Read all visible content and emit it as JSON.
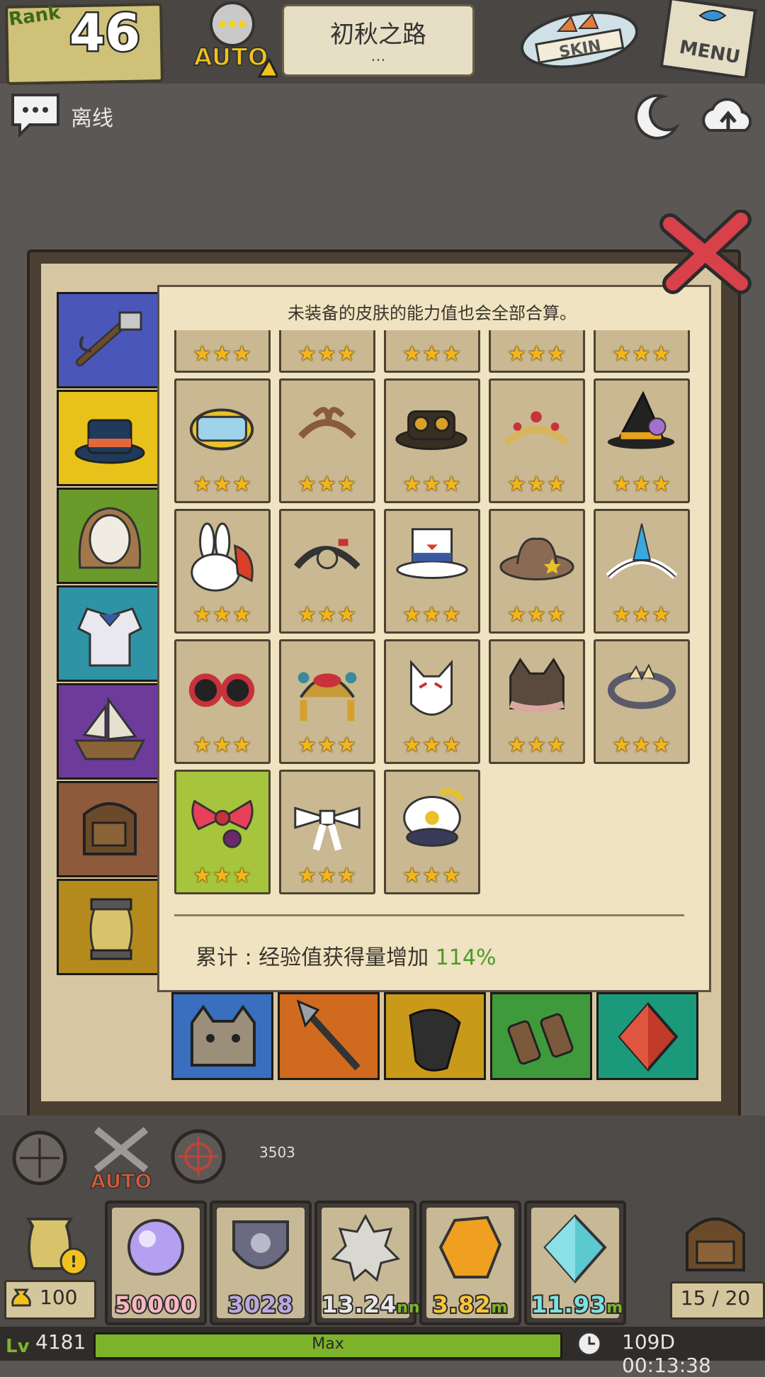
{
  "header": {
    "rank_label": "Rank",
    "rank_value": "46",
    "auto_label": "AUTO",
    "stage_title": "初秋之路",
    "stage_sub": "...",
    "skin_label": "SKIN",
    "menu_label": "MENU"
  },
  "status": {
    "connection": "离线"
  },
  "panel": {
    "note": "未装备的皮肤的能力值也会全部合算。",
    "total_prefix": "累计 : 经验值获得量增加",
    "total_value": "114%",
    "stars": "★★★"
  },
  "side_tabs": [
    {
      "name": "weapon-tab-icon",
      "color": "#4a57b8"
    },
    {
      "name": "hat-tab-icon",
      "color": "#e8c21a"
    },
    {
      "name": "hair-tab-icon",
      "color": "#6a9a2a"
    },
    {
      "name": "outfit-tab-icon",
      "color": "#2f93a6"
    },
    {
      "name": "ship-tab-icon",
      "color": "#6d3c9a"
    },
    {
      "name": "bag-tab-icon",
      "color": "#8d5a3b"
    },
    {
      "name": "lantern-tab-icon",
      "color": "#b58a1d"
    }
  ],
  "skins": [
    {
      "name": "partial-skin-1",
      "rarity": 3
    },
    {
      "name": "partial-skin-2",
      "rarity": 3
    },
    {
      "name": "partial-skin-3",
      "rarity": 3
    },
    {
      "name": "partial-skin-4",
      "rarity": 3
    },
    {
      "name": "partial-skin-5",
      "rarity": 3
    },
    {
      "name": "diving-mask-icon",
      "rarity": 3
    },
    {
      "name": "ribbon-headband-icon",
      "rarity": 3
    },
    {
      "name": "goggle-hat-icon",
      "rarity": 3
    },
    {
      "name": "tiara-icon",
      "rarity": 3
    },
    {
      "name": "witch-hat-icon",
      "rarity": 3
    },
    {
      "name": "bunny-hat-icon",
      "rarity": 3
    },
    {
      "name": "gear-headband-icon",
      "rarity": 3
    },
    {
      "name": "top-hat-icon",
      "rarity": 3
    },
    {
      "name": "sheriff-hat-icon",
      "rarity": 3
    },
    {
      "name": "horn-headband-icon",
      "rarity": 3
    },
    {
      "name": "sunglasses-icon",
      "rarity": 3
    },
    {
      "name": "jeweled-band-icon",
      "rarity": 3
    },
    {
      "name": "fox-mask-icon",
      "rarity": 3
    },
    {
      "name": "cat-ear-hat-icon",
      "rarity": 3
    },
    {
      "name": "laurel-crown-icon",
      "rarity": 3
    },
    {
      "name": "bow-icon",
      "rarity": 3,
      "selected": true
    },
    {
      "name": "white-bow-icon",
      "rarity": 3
    },
    {
      "name": "captain-hat-icon",
      "rarity": 3
    }
  ],
  "bottom_tabs": [
    {
      "name": "cat-tab-icon",
      "color": "#3a6fc0"
    },
    {
      "name": "spear-tab-icon",
      "color": "#d06a1e"
    },
    {
      "name": "pouch-tab-icon",
      "color": "#c99a1a"
    },
    {
      "name": "binoculars-tab-icon",
      "color": "#3e9a3a"
    },
    {
      "name": "gem-tab-icon",
      "color": "#1a9a7a"
    }
  ],
  "hud": {
    "distance": "3503",
    "coins": "100",
    "inventory": "15 / 20",
    "level": "4181",
    "xp_label": "Max",
    "xp_fill": 1.0,
    "timer": "109D 00:13:38"
  },
  "resources": [
    {
      "value": "50000",
      "unit": "",
      "color": "#f7b7c4",
      "icon": "orb-icon"
    },
    {
      "value": "3028",
      "unit": "",
      "color": "#b9a8e0",
      "icon": "skull-shield-icon"
    },
    {
      "value": "13.24",
      "unit": "nn",
      "color": "#e6e6e6",
      "icon": "sun-stone-icon"
    },
    {
      "value": "3.82",
      "unit": "m",
      "color": "#f7c53a",
      "icon": "amber-icon"
    },
    {
      "value": "11.93",
      "unit": "m",
      "color": "#7fe0e0",
      "icon": "diamond-icon"
    }
  ]
}
